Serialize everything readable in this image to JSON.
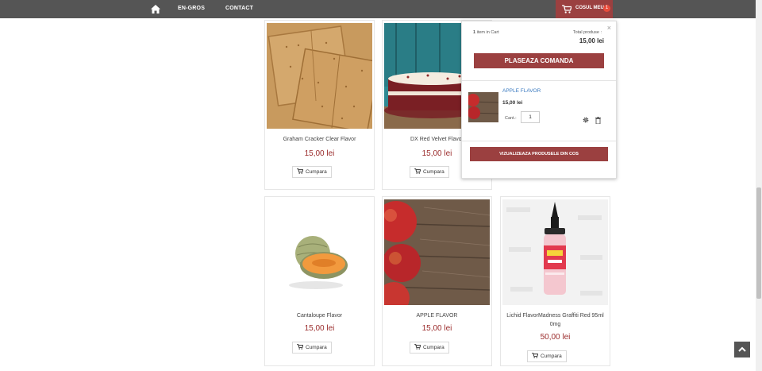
{
  "nav": {
    "links": [
      "EN-GROS",
      "CONTACT"
    ]
  },
  "cart_button": {
    "label": "COSUL MEU",
    "count": "1"
  },
  "cart_popup": {
    "close": "×",
    "count_number": "1",
    "count_text": "item in Cart",
    "total_label": "Total produse :",
    "total_value": "15,00 lei",
    "checkout_label": "PLASEAZA COMANDA",
    "item": {
      "name": "APPLE FLAVOR",
      "price": "15,00 lei",
      "qty_label": "Cant.:",
      "qty": "1"
    },
    "view_cart_label": "VIZUALIZEAZA PRODUSELE DIN COS"
  },
  "products": [
    {
      "name": "Graham Cracker Clear Flavor",
      "price": "15,00 lei",
      "buy_label": "Cumpara"
    },
    {
      "name": "DX Red Velvet Flavor",
      "price": "15,00 lei",
      "buy_label": "Cumpara"
    },
    {
      "name": "Cantaloupe Flavor",
      "price": "15,00 lei",
      "buy_label": "Cumpara"
    },
    {
      "name": "APPLE FLAVOR",
      "price": "15,00 lei",
      "buy_label": "Cumpara"
    },
    {
      "name": "Lichid FlavorMadness Graffiti Red 95ml 0mg",
      "price": "50,00 lei",
      "buy_label": "Cumpara"
    }
  ],
  "colors": {
    "topbar": "#555555",
    "brand": "#9b4040",
    "price": "#9b2c2c",
    "link": "#3b7ac0",
    "badge": "#e74c3c"
  }
}
